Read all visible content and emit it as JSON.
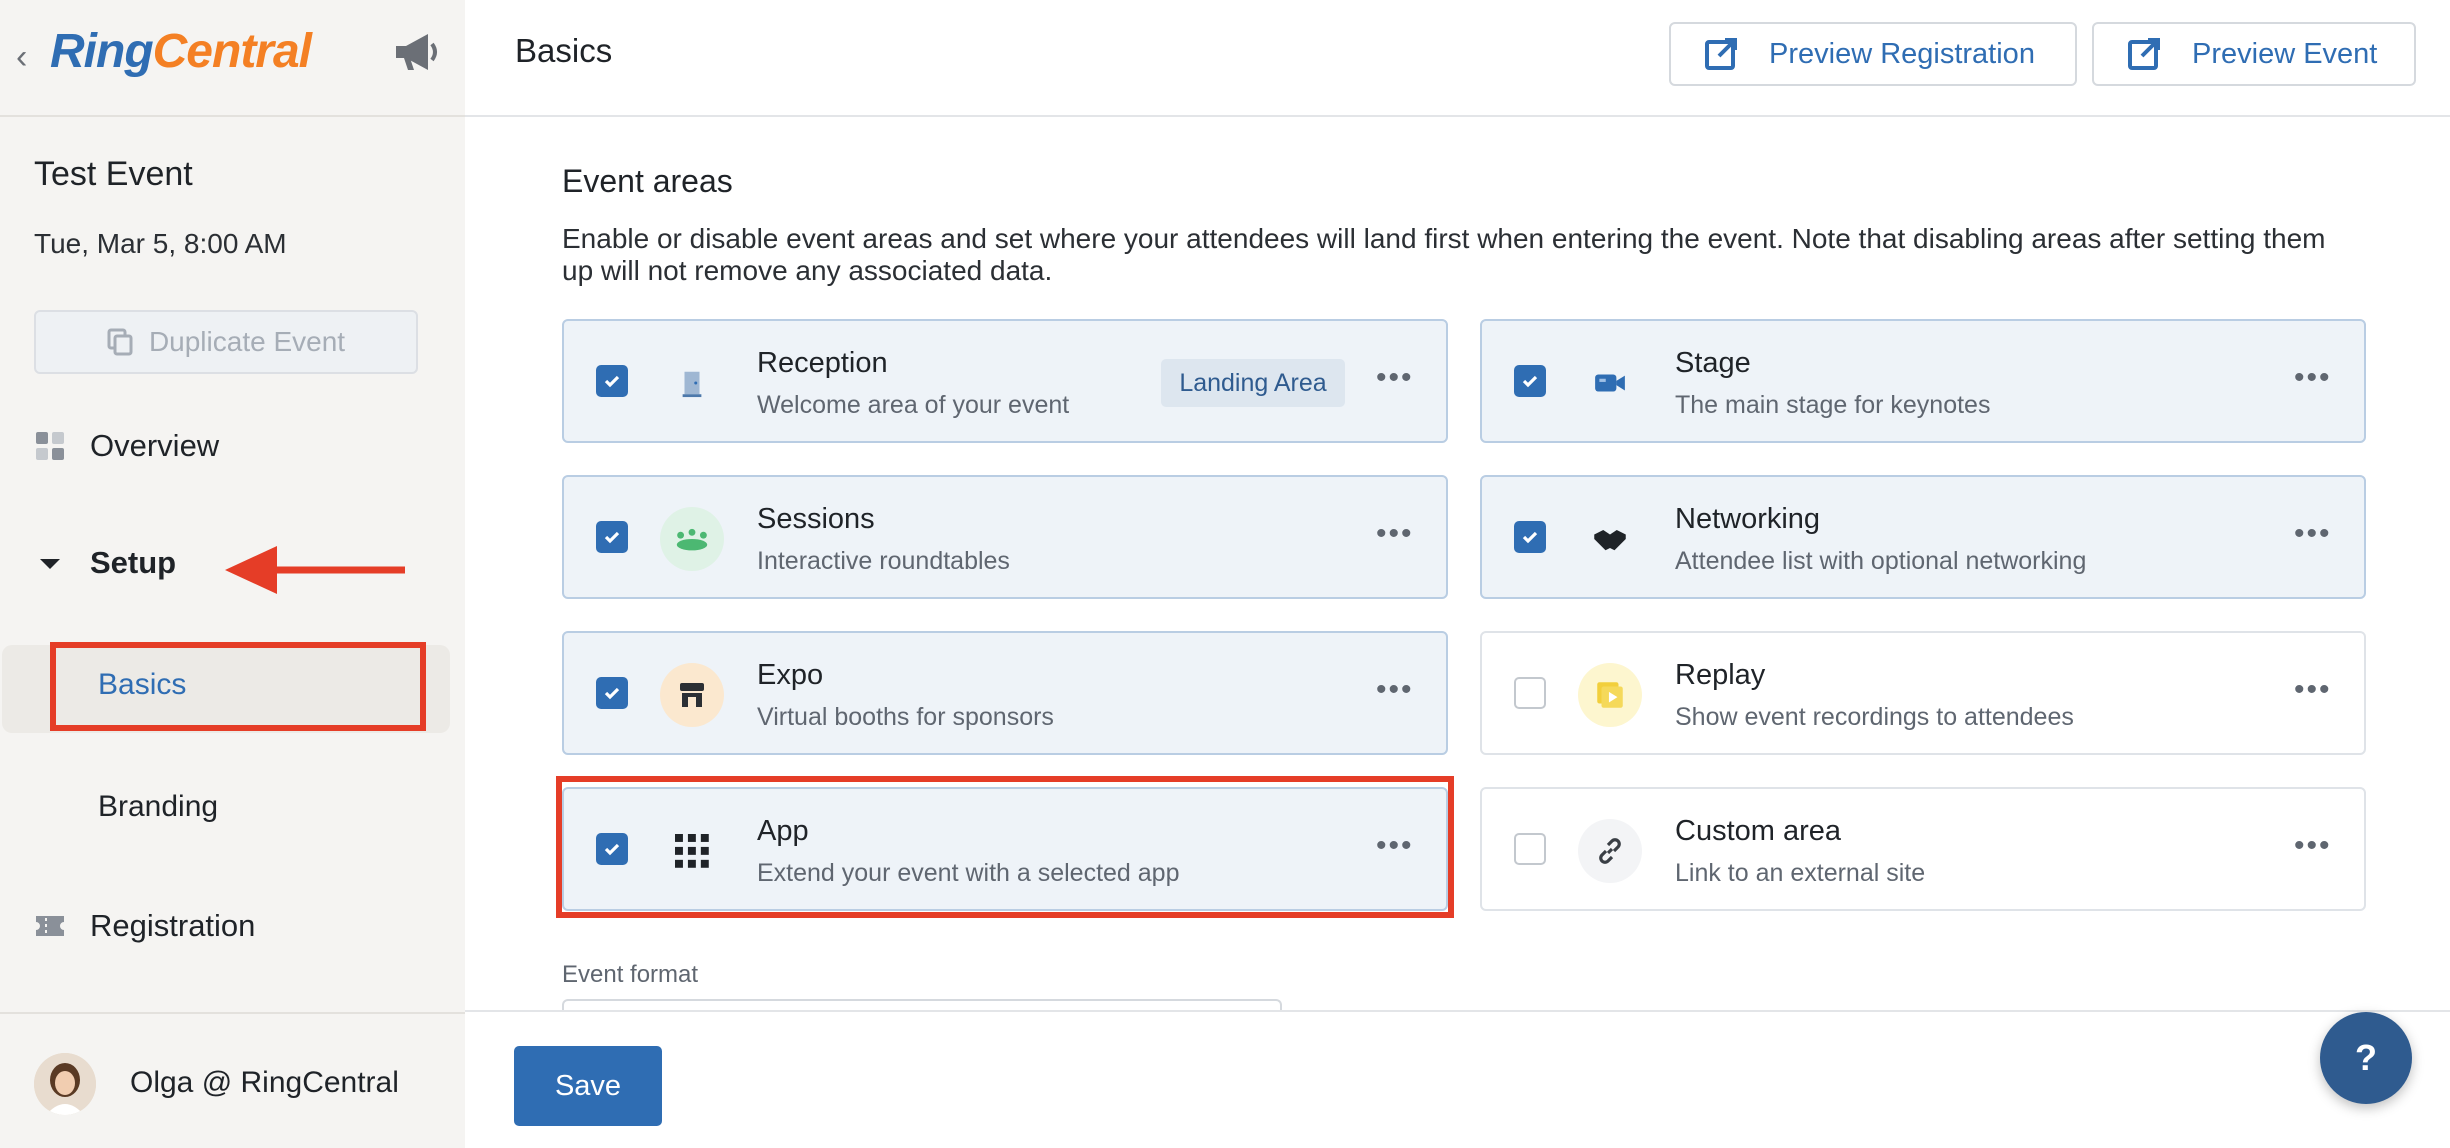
{
  "sidebar": {
    "back_icon": "chevron-left-icon",
    "logo_ring": "Ring",
    "logo_central": "Central",
    "megaphone_icon": "megaphone-icon",
    "event_title": "Test Event",
    "event_date": "Tue, Mar 5, 8:00 AM",
    "duplicate_label": "Duplicate Event",
    "nav": {
      "overview": "Overview",
      "setup": "Setup",
      "basics": "Basics",
      "branding": "Branding",
      "registration": "Registration"
    },
    "user_name": "Olga @ RingCentral"
  },
  "header": {
    "title": "Basics",
    "preview_registration": "Preview Registration",
    "preview_event": "Preview Event"
  },
  "content": {
    "section_title": "Event areas",
    "section_desc": "Enable or disable event areas and set where your attendees will land first when entering the event. Note that disabling areas after setting them up will not remove any associated data.",
    "areas": [
      {
        "name": "Reception",
        "desc": "Welcome area of your event",
        "checked": true,
        "badge": "Landing Area",
        "icon": "door-icon",
        "icon_bg": "#eef3f8"
      },
      {
        "name": "Stage",
        "desc": "The main stage for keynotes",
        "checked": true,
        "icon": "video-camera-icon",
        "icon_bg": "#eef3f8"
      },
      {
        "name": "Sessions",
        "desc": "Interactive roundtables",
        "checked": true,
        "icon": "people-table-icon",
        "icon_bg": "#dff2e6"
      },
      {
        "name": "Networking",
        "desc": "Attendee list with optional networking",
        "checked": true,
        "icon": "handshake-icon",
        "icon_bg": "#eef3f8"
      },
      {
        "name": "Expo",
        "desc": "Virtual booths for sponsors",
        "checked": true,
        "icon": "booth-icon",
        "icon_bg": "#fbe8cf"
      },
      {
        "name": "Replay",
        "desc": "Show event recordings to attendees",
        "checked": false,
        "icon": "replay-icon",
        "icon_bg": "#fdf6cf"
      },
      {
        "name": "App",
        "desc": "Extend your event with a selected app",
        "checked": true,
        "icon": "app-grid-icon",
        "icon_bg": "#eef3f8"
      },
      {
        "name": "Custom area",
        "desc": "Link to an external site",
        "checked": false,
        "icon": "link-icon",
        "icon_bg": "#f3f4f6"
      }
    ],
    "event_format_label": "Event format"
  },
  "footer": {
    "save_label": "Save",
    "help_label": "?"
  },
  "colors": {
    "accent": "#2f6db3",
    "highlight": "#e53d27",
    "card_bg": "#eef3f8"
  }
}
